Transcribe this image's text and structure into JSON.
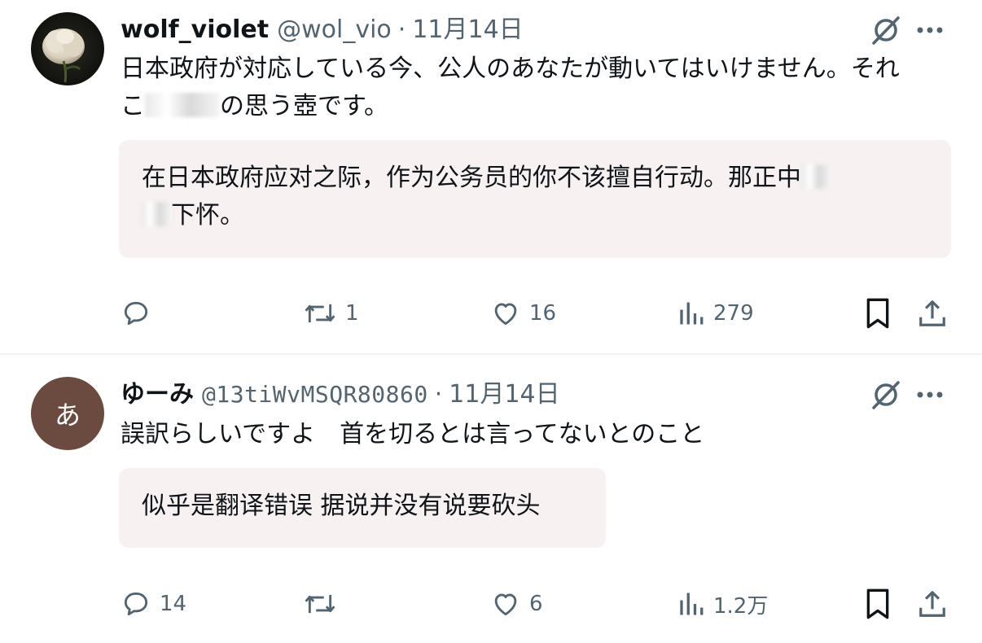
{
  "posts": [
    {
      "avatar": {
        "type": "photo",
        "subject": "white-rose"
      },
      "name": "wolf_violet",
      "handle": "@wol_vio",
      "separator": "·",
      "date": "11月14日",
      "text_line1": "日本政府が対応している今、公人のあなたが動いてはいけません。それ",
      "text_line2_a": "こ",
      "text_line2_b": "の思う壺です。",
      "translation_line1": "在日本政府应对之际，作为公务员的你不该擅自行动。那正中",
      "translation_line2": "下怀。",
      "stats": {
        "replies": "",
        "reposts": "1",
        "likes": "16",
        "views": "279"
      }
    },
    {
      "avatar": {
        "type": "letter",
        "letter": "あ",
        "color": "#6b4a3f"
      },
      "name": "ゆーみ",
      "handle": "@13tiWvMSQR80860",
      "separator": "·",
      "date": "11月14日",
      "text": "誤訳らしいですよ　首を切るとは言ってないとのこと",
      "translation": "似乎是翻译错误 据说并没有说要砍头",
      "stats": {
        "replies": "14",
        "reposts": "",
        "likes": "6",
        "views": "1.2万"
      }
    }
  ],
  "icons": {
    "reply": "reply-icon",
    "repost": "repost-icon",
    "like": "heart-icon",
    "views": "bar-chart-icon",
    "bookmark": "bookmark-icon",
    "share": "share-icon",
    "grok": "grok-icon",
    "more": "more-icon"
  },
  "colors": {
    "text": "#0f1419",
    "secondary": "#536471",
    "translation_bg": "#f7f1f1",
    "divider": "#eff3f4"
  }
}
